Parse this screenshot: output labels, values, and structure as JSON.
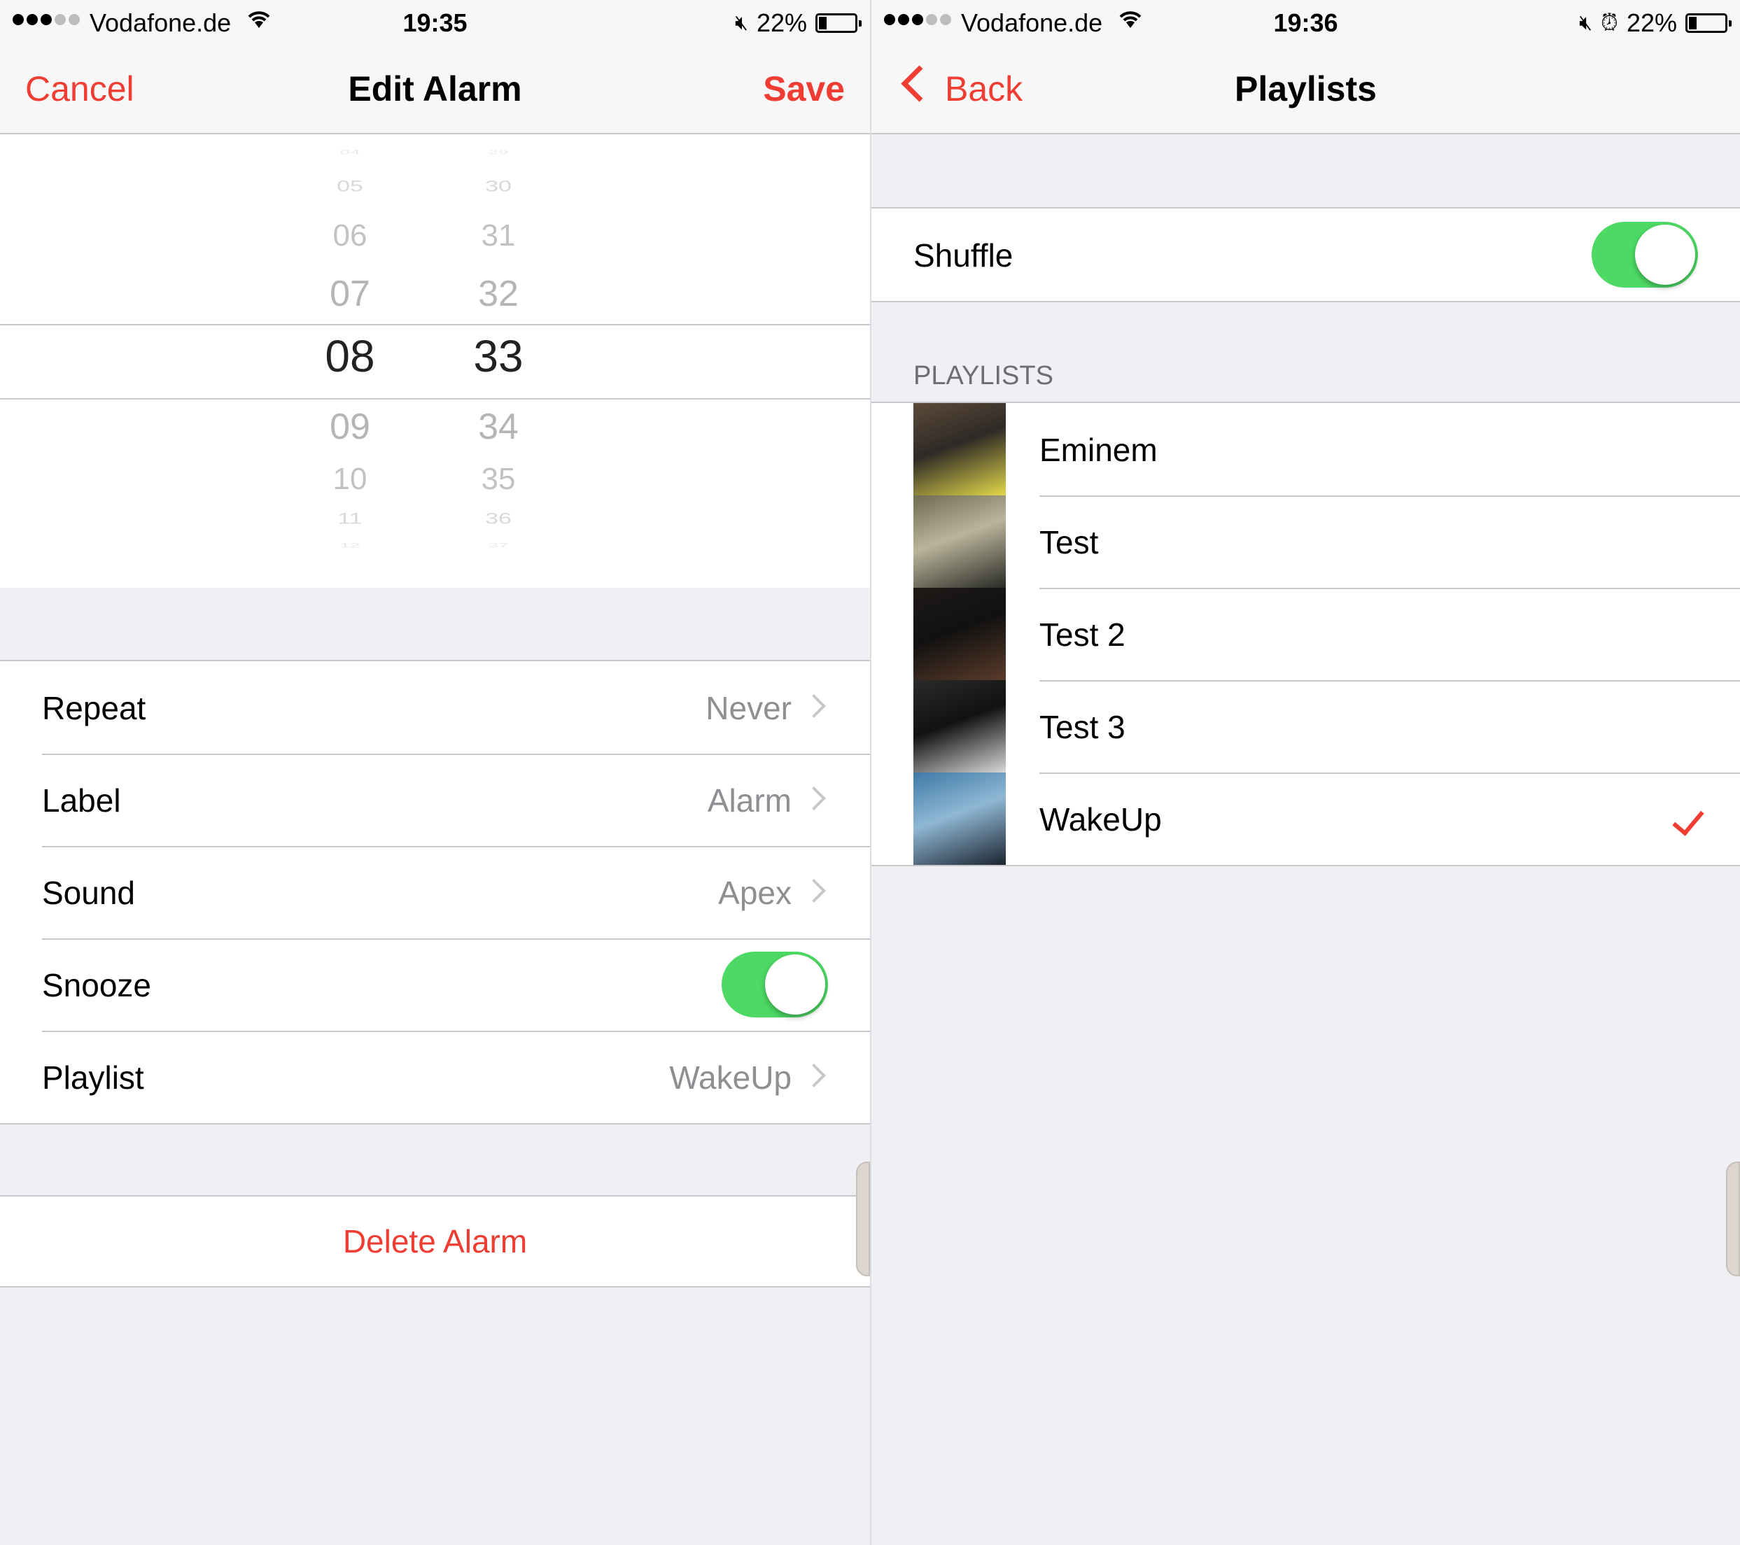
{
  "left": {
    "status": {
      "carrier": "Vodafone.de",
      "time": "19:35",
      "battery": "22%",
      "battery_level": 0.22,
      "signal_bars": 3,
      "signal_total": 5
    },
    "nav": {
      "cancel": "Cancel",
      "title": "Edit Alarm",
      "save": "Save"
    },
    "picker": {
      "hours": [
        "04",
        "05",
        "06",
        "07",
        "08",
        "09",
        "10",
        "11",
        "12"
      ],
      "minutes": [
        "29",
        "30",
        "31",
        "32",
        "33",
        "34",
        "35",
        "36",
        "37"
      ],
      "selected_hour": "08",
      "selected_minute": "33"
    },
    "settings": [
      {
        "label": "Repeat",
        "value": "Never"
      },
      {
        "label": "Label",
        "value": "Alarm"
      },
      {
        "label": "Sound",
        "value": "Apex"
      },
      {
        "label": "Snooze",
        "toggle": true
      },
      {
        "label": "Playlist",
        "value": "WakeUp"
      }
    ],
    "delete_label": "Delete Alarm"
  },
  "right": {
    "status": {
      "carrier": "Vodafone.de",
      "time": "19:36",
      "battery": "22%",
      "battery_level": 0.22,
      "signal_bars": 3,
      "signal_total": 5
    },
    "nav": {
      "back": "Back",
      "title": "Playlists"
    },
    "shuffle": {
      "label": "Shuffle",
      "on": true
    },
    "section_header": "PLAYLISTS",
    "playlists": [
      {
        "name": "Eminem",
        "art": "B.o.B album cover",
        "colors": [
          "#5c4a3a",
          "#e2d84a",
          "#2f2a26"
        ],
        "selected": false
      },
      {
        "name": "Test",
        "art": "Kendrick Lamar album cover",
        "colors": [
          "#6f6c52",
          "#2a2a26",
          "#b9b49a"
        ],
        "selected": false
      },
      {
        "name": "Test 2",
        "art": "2Pac album cover",
        "colors": [
          "#1e1a18",
          "#5a3b2a",
          "#111111"
        ],
        "selected": false
      },
      {
        "name": "Test 3",
        "art": "Jay-Z album cover",
        "colors": [
          "#2b2b2b",
          "#d8d8d8",
          "#111111"
        ],
        "selected": false
      },
      {
        "name": "WakeUp",
        "art": "Snoop Dogg album cover",
        "colors": [
          "#3e7aa6",
          "#1b2430",
          "#8fb7d4"
        ],
        "selected": true
      }
    ]
  },
  "colors": {
    "accent": "#ef3d33",
    "toggle_on": "#4cd964",
    "group_bg": "#efeff4"
  }
}
